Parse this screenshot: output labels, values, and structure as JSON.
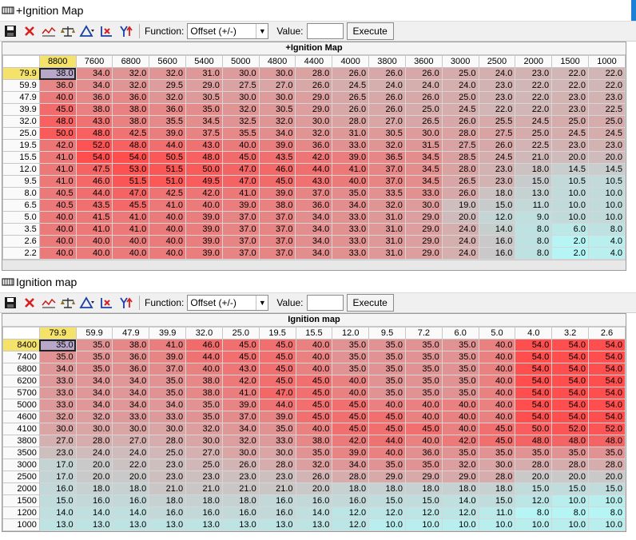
{
  "colors": {
    "hot": "#ff4e4e",
    "cool": "#b6f5f5",
    "header_selected": "#f5e26a",
    "title_accent": "#1e7fd6"
  },
  "windows": [
    {
      "window_title": "+Ignition Map",
      "grid_title": "+Ignition Map",
      "toolbar": {
        "icons": [
          "save-icon",
          "delete-icon",
          "graph-icon",
          "scale-icon",
          "interpolate-icon",
          "axis-icon",
          "fill-icon"
        ],
        "function_label": "Function:",
        "function_value": "Offset (+/-)",
        "value_label": "Value:",
        "value_input": "",
        "execute_label": "Execute"
      },
      "columns": [
        "8800",
        "7600",
        "6800",
        "5600",
        "5400",
        "5000",
        "4800",
        "4400",
        "4000",
        "3800",
        "3600",
        "3000",
        "2500",
        "2000",
        "1500",
        "1000"
      ],
      "selected_col": 0,
      "selected_row": 0,
      "rows": [
        {
          "label": "79.9",
          "values": [
            "38.0",
            "34.0",
            "32.0",
            "32.0",
            "31.0",
            "30.0",
            "30.0",
            "28.0",
            "26.0",
            "26.0",
            "26.0",
            "25.0",
            "24.0",
            "23.0",
            "22.0",
            "22.0"
          ]
        },
        {
          "label": "59.9",
          "values": [
            "36.0",
            "34.0",
            "32.0",
            "29.5",
            "29.0",
            "27.5",
            "27.0",
            "26.0",
            "24.5",
            "24.0",
            "24.0",
            "24.0",
            "23.0",
            "22.0",
            "22.0",
            "22.0"
          ]
        },
        {
          "label": "47.9",
          "values": [
            "40.0",
            "36.0",
            "36.0",
            "32.0",
            "30.5",
            "30.0",
            "30.0",
            "29.0",
            "26.5",
            "26.0",
            "26.0",
            "25.0",
            "23.0",
            "22.0",
            "23.0",
            "23.0"
          ]
        },
        {
          "label": "39.9",
          "values": [
            "45.0",
            "38.0",
            "38.0",
            "36.0",
            "35.0",
            "32.0",
            "30.5",
            "29.0",
            "26.0",
            "26.0",
            "25.0",
            "24.5",
            "22.0",
            "22.0",
            "23.0",
            "22.5"
          ]
        },
        {
          "label": "32.0",
          "values": [
            "48.0",
            "43.0",
            "38.0",
            "35.5",
            "34.5",
            "32.5",
            "32.0",
            "30.0",
            "28.0",
            "27.0",
            "26.5",
            "26.0",
            "25.5",
            "24.5",
            "25.0",
            "25.0"
          ]
        },
        {
          "label": "25.0",
          "values": [
            "50.0",
            "48.0",
            "42.5",
            "39.0",
            "37.5",
            "35.5",
            "34.0",
            "32.0",
            "31.0",
            "30.5",
            "30.0",
            "28.0",
            "27.5",
            "25.0",
            "24.5",
            "24.5"
          ]
        },
        {
          "label": "19.5",
          "values": [
            "42.0",
            "52.0",
            "48.0",
            "44.0",
            "43.0",
            "40.0",
            "39.0",
            "36.0",
            "33.0",
            "32.0",
            "31.5",
            "27.5",
            "26.0",
            "22.5",
            "23.0",
            "23.0"
          ]
        },
        {
          "label": "15.5",
          "values": [
            "41.0",
            "54.0",
            "54.0",
            "50.5",
            "48.0",
            "45.0",
            "43.5",
            "42.0",
            "39.0",
            "36.5",
            "34.5",
            "28.5",
            "24.5",
            "21.0",
            "20.0",
            "20.0"
          ]
        },
        {
          "label": "12.0",
          "values": [
            "41.0",
            "47.5",
            "53.0",
            "51.5",
            "50.0",
            "47.0",
            "46.0",
            "44.0",
            "41.0",
            "37.0",
            "34.5",
            "28.0",
            "23.0",
            "18.0",
            "14.5",
            "14.5"
          ]
        },
        {
          "label": "9.5",
          "values": [
            "41.0",
            "46.0",
            "51.5",
            "51.0",
            "49.5",
            "47.0",
            "45.0",
            "43.0",
            "40.0",
            "37.0",
            "34.5",
            "26.5",
            "23.0",
            "15.0",
            "10.5",
            "10.5"
          ]
        },
        {
          "label": "8.0",
          "values": [
            "40.5",
            "44.0",
            "47.0",
            "42.5",
            "42.0",
            "41.0",
            "39.0",
            "37.0",
            "35.0",
            "33.5",
            "33.0",
            "26.0",
            "18.0",
            "13.0",
            "10.0",
            "10.0"
          ]
        },
        {
          "label": "6.5",
          "values": [
            "40.5",
            "43.5",
            "45.5",
            "41.0",
            "40.0",
            "39.0",
            "38.0",
            "36.0",
            "34.0",
            "32.0",
            "30.0",
            "19.0",
            "15.0",
            "11.0",
            "10.0",
            "10.0"
          ]
        },
        {
          "label": "5.0",
          "values": [
            "40.0",
            "41.5",
            "41.0",
            "40.0",
            "39.0",
            "37.0",
            "37.0",
            "34.0",
            "33.0",
            "31.0",
            "29.0",
            "20.0",
            "12.0",
            "9.0",
            "10.0",
            "10.0"
          ]
        },
        {
          "label": "3.5",
          "values": [
            "40.0",
            "41.0",
            "41.0",
            "40.0",
            "39.0",
            "37.0",
            "37.0",
            "34.0",
            "33.0",
            "31.0",
            "29.0",
            "24.0",
            "14.0",
            "8.0",
            "6.0",
            "8.0"
          ]
        },
        {
          "label": "2.6",
          "values": [
            "40.0",
            "40.0",
            "40.0",
            "40.0",
            "39.0",
            "37.0",
            "37.0",
            "34.0",
            "33.0",
            "31.0",
            "29.0",
            "24.0",
            "16.0",
            "8.0",
            "2.0",
            "4.0"
          ]
        },
        {
          "label": "2.2",
          "values": [
            "40.0",
            "40.0",
            "40.0",
            "40.0",
            "39.0",
            "37.0",
            "37.0",
            "34.0",
            "33.0",
            "31.0",
            "29.0",
            "24.0",
            "16.0",
            "8.0",
            "2.0",
            "4.0"
          ]
        }
      ]
    },
    {
      "window_title": "Ignition map",
      "grid_title": "Ignition map",
      "toolbar": {
        "icons": [
          "save-icon",
          "delete-icon",
          "graph-icon",
          "scale-icon",
          "interpolate-icon",
          "axis-icon",
          "fill-icon"
        ],
        "function_label": "Function:",
        "function_value": "Offset (+/-)",
        "value_label": "Value:",
        "value_input": "",
        "execute_label": "Execute"
      },
      "columns": [
        "79.9",
        "59.9",
        "47.9",
        "39.9",
        "32.0",
        "25.0",
        "19.5",
        "15.5",
        "12.0",
        "9.5",
        "7.2",
        "6.0",
        "5.0",
        "4.0",
        "3.2",
        "2.6"
      ],
      "selected_col": 0,
      "selected_row": 0,
      "rows": [
        {
          "label": "8400",
          "values": [
            "35.0",
            "35.0",
            "38.0",
            "41.0",
            "46.0",
            "45.0",
            "45.0",
            "40.0",
            "35.0",
            "35.0",
            "35.0",
            "35.0",
            "40.0",
            "54.0",
            "54.0",
            "54.0"
          ]
        },
        {
          "label": "7400",
          "values": [
            "35.0",
            "35.0",
            "36.0",
            "39.0",
            "44.0",
            "45.0",
            "45.0",
            "40.0",
            "35.0",
            "35.0",
            "35.0",
            "35.0",
            "40.0",
            "54.0",
            "54.0",
            "54.0"
          ]
        },
        {
          "label": "6800",
          "values": [
            "34.0",
            "35.0",
            "36.0",
            "37.0",
            "40.0",
            "43.0",
            "45.0",
            "40.0",
            "35.0",
            "35.0",
            "35.0",
            "35.0",
            "40.0",
            "54.0",
            "54.0",
            "54.0"
          ]
        },
        {
          "label": "6200",
          "values": [
            "33.0",
            "34.0",
            "34.0",
            "35.0",
            "38.0",
            "42.0",
            "45.0",
            "45.0",
            "40.0",
            "35.0",
            "35.0",
            "35.0",
            "40.0",
            "54.0",
            "54.0",
            "54.0"
          ]
        },
        {
          "label": "5700",
          "values": [
            "33.0",
            "34.0",
            "34.0",
            "35.0",
            "38.0",
            "41.0",
            "47.0",
            "45.0",
            "40.0",
            "35.0",
            "35.0",
            "35.0",
            "40.0",
            "54.0",
            "54.0",
            "54.0"
          ]
        },
        {
          "label": "5000",
          "values": [
            "33.0",
            "34.0",
            "34.0",
            "34.0",
            "35.0",
            "39.0",
            "44.0",
            "45.0",
            "45.0",
            "40.0",
            "40.0",
            "40.0",
            "40.0",
            "54.0",
            "54.0",
            "54.0"
          ]
        },
        {
          "label": "4600",
          "values": [
            "32.0",
            "32.0",
            "33.0",
            "33.0",
            "35.0",
            "37.0",
            "39.0",
            "45.0",
            "45.0",
            "45.0",
            "40.0",
            "40.0",
            "40.0",
            "54.0",
            "54.0",
            "54.0"
          ]
        },
        {
          "label": "4100",
          "values": [
            "30.0",
            "30.0",
            "30.0",
            "30.0",
            "32.0",
            "34.0",
            "35.0",
            "40.0",
            "45.0",
            "45.0",
            "45.0",
            "40.0",
            "45.0",
            "50.0",
            "52.0",
            "52.0"
          ]
        },
        {
          "label": "3800",
          "values": [
            "27.0",
            "28.0",
            "27.0",
            "28.0",
            "30.0",
            "32.0",
            "33.0",
            "38.0",
            "42.0",
            "44.0",
            "40.0",
            "42.0",
            "45.0",
            "48.0",
            "48.0",
            "48.0"
          ]
        },
        {
          "label": "3500",
          "values": [
            "23.0",
            "24.0",
            "24.0",
            "25.0",
            "27.0",
            "30.0",
            "30.0",
            "35.0",
            "39.0",
            "40.0",
            "36.0",
            "35.0",
            "35.0",
            "35.0",
            "35.0",
            "35.0"
          ]
        },
        {
          "label": "3000",
          "values": [
            "17.0",
            "20.0",
            "22.0",
            "23.0",
            "25.0",
            "26.0",
            "28.0",
            "32.0",
            "34.0",
            "35.0",
            "35.0",
            "32.0",
            "30.0",
            "28.0",
            "28.0",
            "28.0"
          ]
        },
        {
          "label": "2500",
          "values": [
            "17.0",
            "20.0",
            "20.0",
            "23.0",
            "23.0",
            "23.0",
            "23.0",
            "26.0",
            "28.0",
            "29.0",
            "29.0",
            "29.0",
            "28.0",
            "20.0",
            "20.0",
            "20.0"
          ]
        },
        {
          "label": "2000",
          "values": [
            "16.0",
            "18.0",
            "18.0",
            "21.0",
            "21.0",
            "21.0",
            "21.0",
            "20.0",
            "18.0",
            "18.0",
            "18.0",
            "18.0",
            "18.0",
            "15.0",
            "15.0",
            "15.0"
          ]
        },
        {
          "label": "1500",
          "values": [
            "15.0",
            "16.0",
            "16.0",
            "18.0",
            "18.0",
            "18.0",
            "16.0",
            "16.0",
            "16.0",
            "15.0",
            "15.0",
            "14.0",
            "15.0",
            "12.0",
            "10.0",
            "10.0"
          ]
        },
        {
          "label": "1200",
          "values": [
            "14.0",
            "14.0",
            "14.0",
            "16.0",
            "16.0",
            "16.0",
            "16.0",
            "14.0",
            "12.0",
            "12.0",
            "12.0",
            "12.0",
            "11.0",
            "8.0",
            "8.0",
            "8.0"
          ]
        },
        {
          "label": "1000",
          "values": [
            "13.0",
            "13.0",
            "13.0",
            "13.0",
            "13.0",
            "13.0",
            "13.0",
            "13.0",
            "12.0",
            "10.0",
            "10.0",
            "10.0",
            "10.0",
            "10.0",
            "10.0",
            "10.0"
          ]
        }
      ]
    }
  ]
}
